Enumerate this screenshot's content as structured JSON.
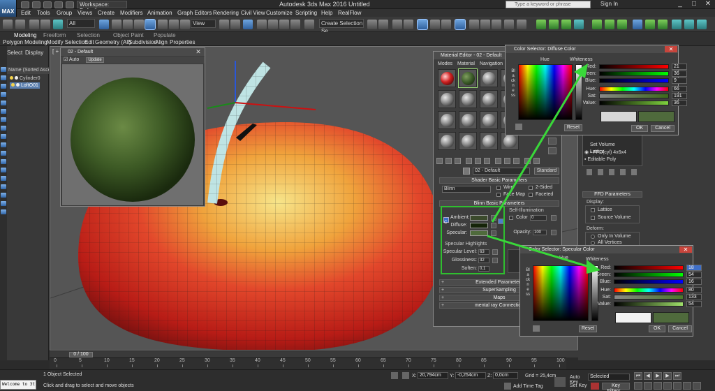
{
  "titlebar": {
    "logo": "MAX",
    "workspace": "Workspace: Default",
    "title": "Autodesk 3ds Max 2016       Untitled",
    "search_placeholder": "Type a keyword or phrase",
    "sign_in": "Sign In",
    "window_buttons": [
      "_",
      "□",
      "✕"
    ]
  },
  "menubar": {
    "items": [
      "Edit",
      "Tools",
      "Group",
      "Views",
      "Create",
      "Modifiers",
      "Animation",
      "Graph Editors",
      "Rendering",
      "Civil View",
      "Customize",
      "Scripting",
      "Help",
      "RealFlow"
    ]
  },
  "toolbar": {
    "selection_filter": "All",
    "reference_coord": "View",
    "named_selection": "Create Selection Se"
  },
  "ribbon": {
    "tabs": [
      "Modeling",
      "Freeform",
      "Selection",
      "Object Paint",
      "Populate"
    ],
    "subtabs": [
      "Polygon Modeling",
      "Modify Selection",
      "Edit",
      "Geometry (All)",
      "Subdivision",
      "Align",
      "Properties"
    ]
  },
  "explorer": {
    "tabs": [
      "Select",
      "Display"
    ],
    "header": "Name (Sorted Ascen",
    "rows": [
      "Cylinder0",
      "LoftO01"
    ]
  },
  "viewport": {
    "label": "[ + ]"
  },
  "preview": {
    "title": "02 - Default",
    "auto": "Auto",
    "update": "Update",
    "close": "✕"
  },
  "material_editor": {
    "title": "Material Editor - 02 - Default",
    "menu": [
      "Modes",
      "Material",
      "Navigation"
    ],
    "material_name": "02 - Default",
    "material_type": "Standard",
    "rollouts": {
      "shader_basic": "Shader Basic Parameters",
      "blinn_basic": "Blinn Basic Parameters",
      "extended": "Extended Parameters",
      "supersampling": "SuperSampling",
      "maps": "Maps",
      "mental_ray": "mental ray Connection"
    },
    "shader": "Blinn",
    "shader_options": [
      "Wire",
      "2-Sided",
      "Face Map",
      "Faceted"
    ],
    "self_illum": {
      "title": "Self-Illumination",
      "color_label": "Color",
      "color_value": "0"
    },
    "opacity": {
      "label": "Opacity:",
      "value": "100"
    },
    "colors": {
      "ambient": "Ambient:",
      "diffuse": "Diffuse:",
      "specular": "Specular:",
      "lock": "C"
    },
    "specular_highlights": {
      "title": "Specular Highlights",
      "level_label": "Specular Level:",
      "level": "63",
      "gloss_label": "Glossiness:",
      "gloss": "32",
      "soften_label": "Soften:",
      "soften": "0,1"
    }
  },
  "command_panel": {
    "modifiers": [
      "Lattice",
      "Set Volume",
      "FFD(cyl) 4x6x4",
      "Editable Poly"
    ],
    "ffd_rollout": "FFD Parameters",
    "display_label": "Display:",
    "display_options": [
      "Lattice",
      "Source Volume"
    ],
    "deform_label": "Deform:",
    "deform_options": [
      "Only In Volume",
      "All Vertices"
    ]
  },
  "diffuse_selector": {
    "title": "Color Selector: Diffuse Color",
    "hue_label": "Hue",
    "whiteness_label": "Whiteness",
    "blackness_label": "Blackness",
    "rows": [
      {
        "label": "Red:",
        "value": "21"
      },
      {
        "label": "Green:",
        "value": "36"
      },
      {
        "label": "Blue:",
        "value": "9"
      },
      {
        "label": "Hue:",
        "value": "66"
      },
      {
        "label": "Sat:",
        "value": "191"
      },
      {
        "label": "Value:",
        "value": "36"
      }
    ],
    "reset": "Reset",
    "ok": "OK",
    "cancel": "Cancel",
    "color": "#152409"
  },
  "specular_selector": {
    "title": "Color Selector: Specular Color",
    "hue_label": "Hue",
    "whiteness_label": "Whiteness",
    "blackness_label": "Blackness",
    "rows": [
      {
        "label": "Red:",
        "value": "18"
      },
      {
        "label": "Green:",
        "value": "54"
      },
      {
        "label": "Blue:",
        "value": "16"
      },
      {
        "label": "Hue:",
        "value": "80"
      },
      {
        "label": "Sat:",
        "value": "133"
      },
      {
        "label": "Value:",
        "value": "54"
      }
    ],
    "reset": "Reset",
    "ok": "OK",
    "cancel": "Cancel",
    "color": "#4f6a3c"
  },
  "timeline": {
    "slider": "0 / 100",
    "ticks": [
      "0",
      "5",
      "10",
      "15",
      "20",
      "25",
      "30",
      "35",
      "40",
      "45",
      "50",
      "55",
      "60",
      "65",
      "70",
      "75",
      "80",
      "85",
      "90",
      "95",
      "100"
    ]
  },
  "statusbar": {
    "maxscript": "Welcome to 3t",
    "selected": "1 Object Selected",
    "prompt": "Click and drag to select and move objects",
    "x_label": "X:",
    "x": "20,794cm",
    "y_label": "Y:",
    "y": "-0,254cm",
    "z_label": "Z:",
    "z": "0,0cm",
    "grid": "Grid = 25,4cm",
    "add_time_tag": "Add Time Tag",
    "auto_key": "Auto Key",
    "auto_key_value": "Selected",
    "set_key": "Set Key",
    "key_filters": "Key Filters..."
  },
  "colors": {
    "accent_green": "#2fbf2f",
    "selection_blue": "#5b7fae",
    "close_red": "#c8453c"
  }
}
